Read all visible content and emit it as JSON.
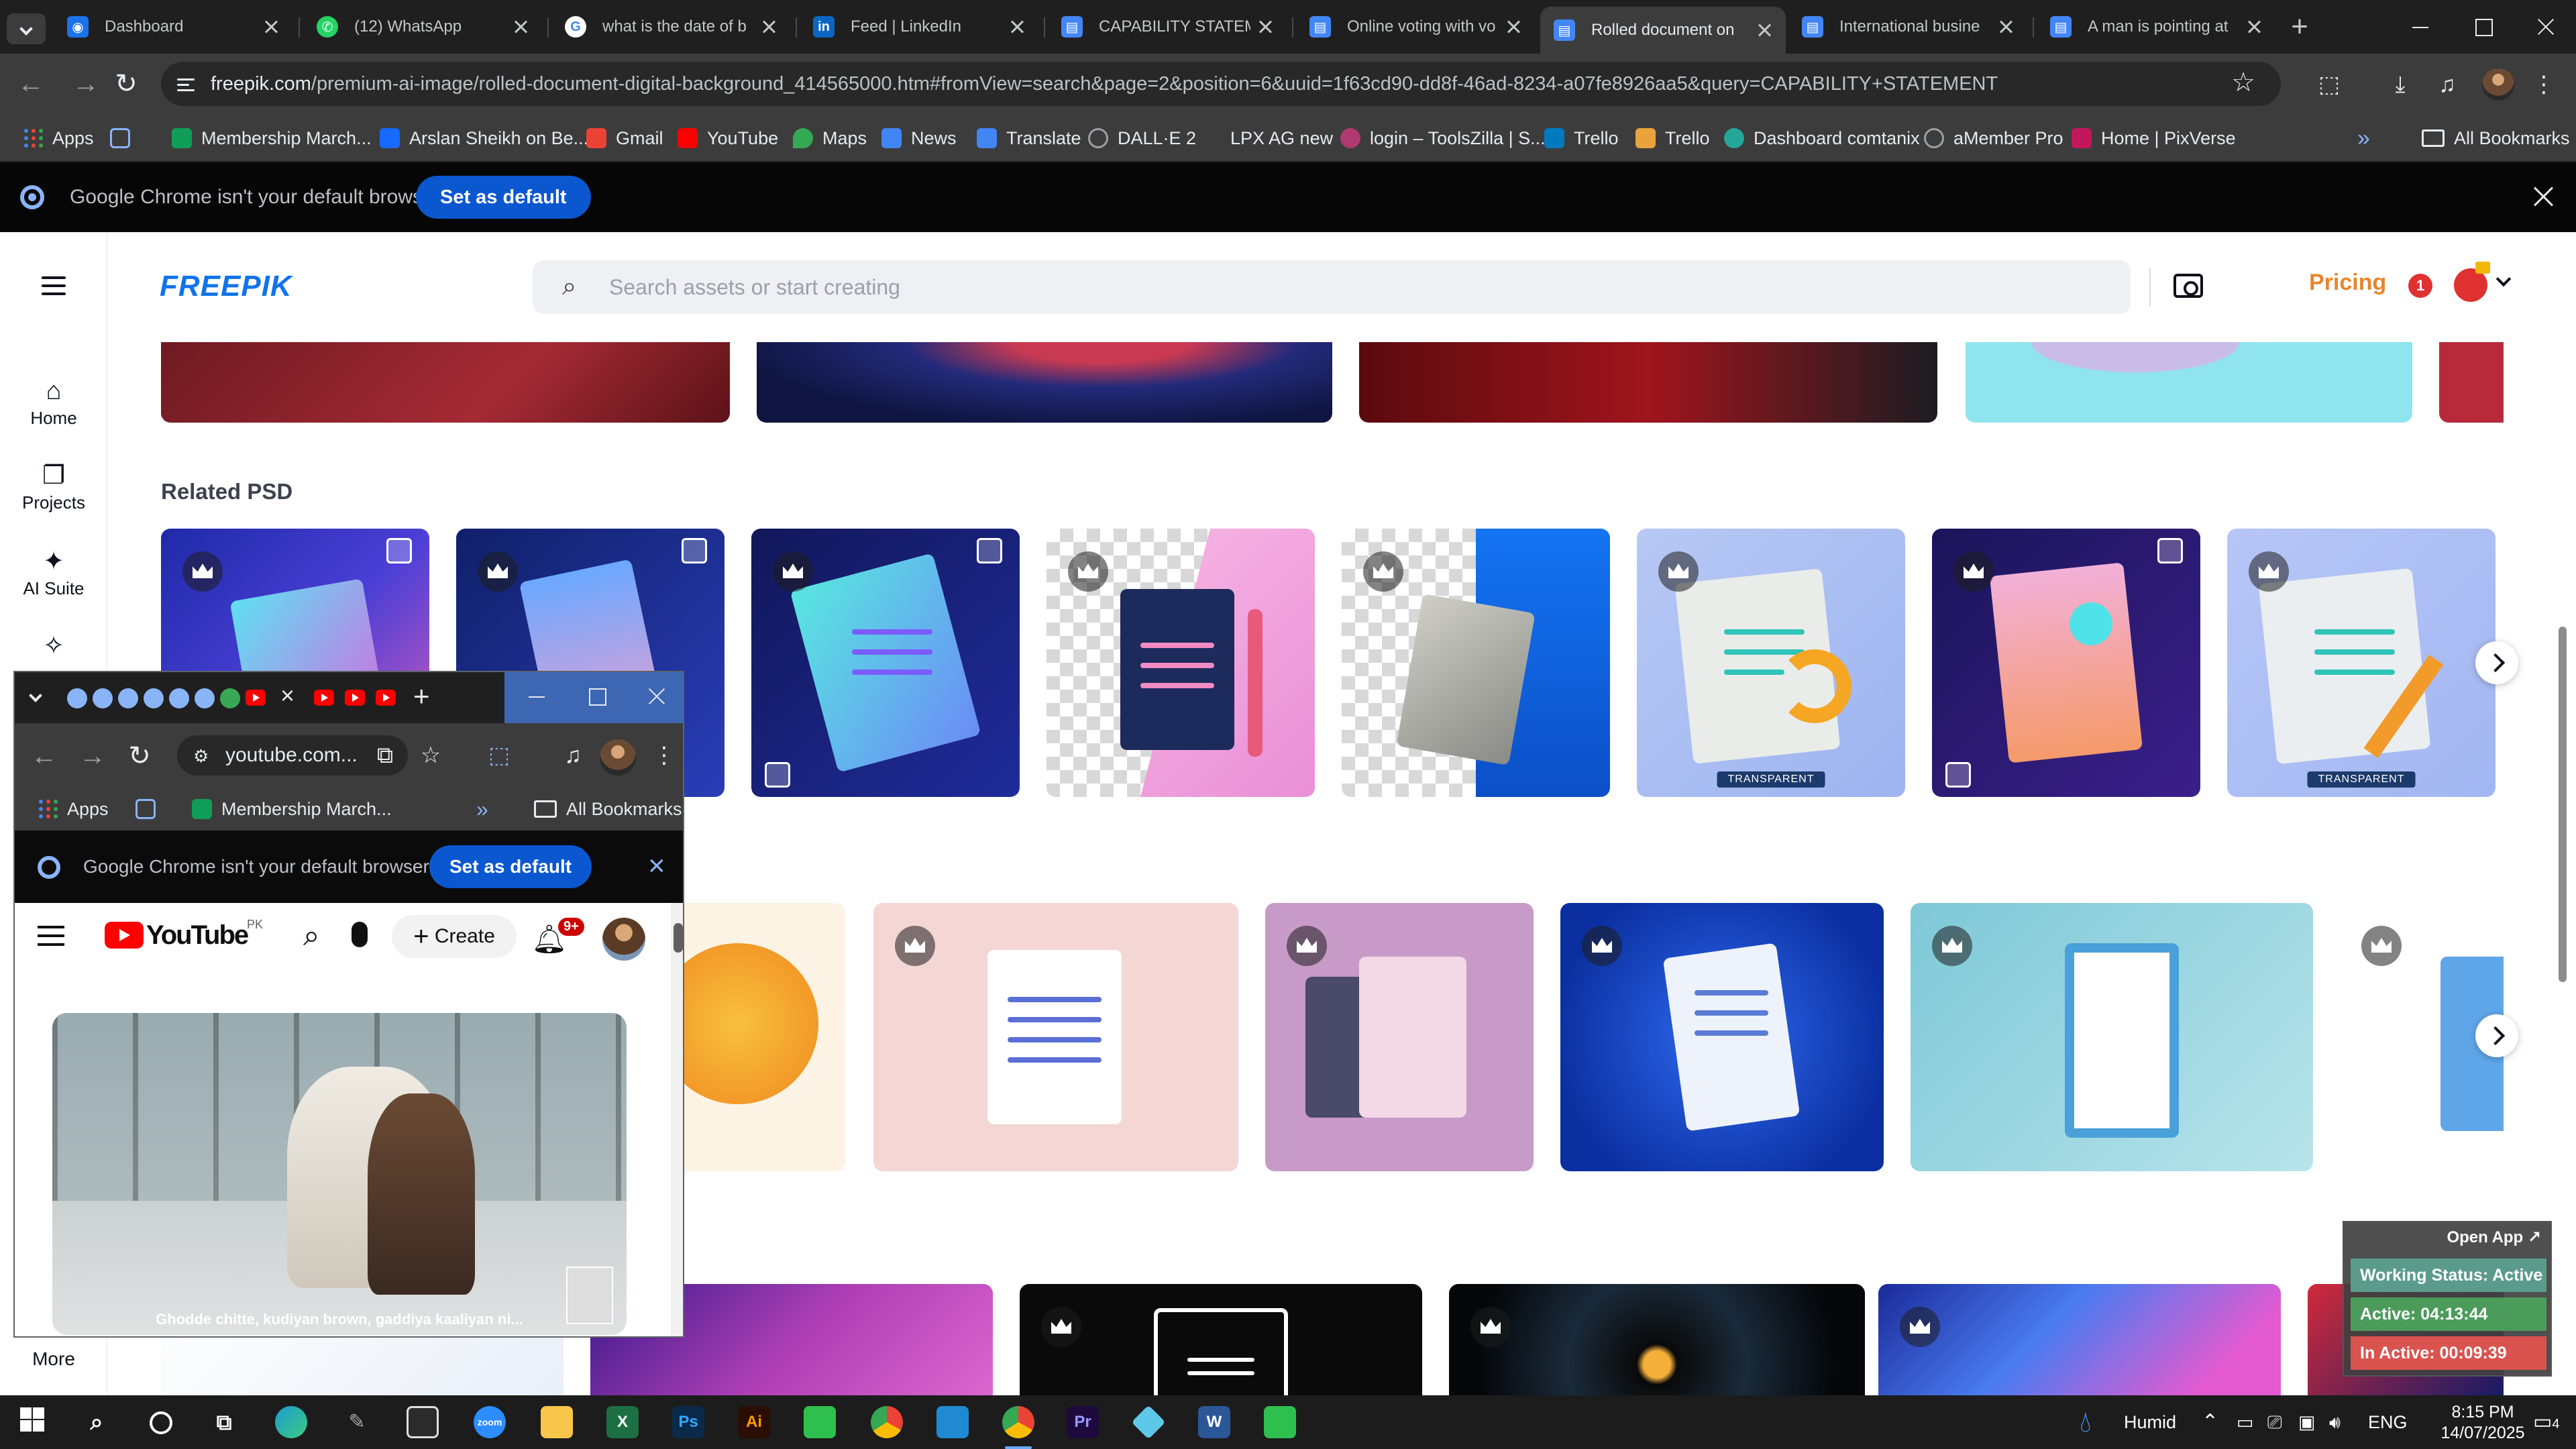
{
  "browser": {
    "tabs": [
      {
        "title": "Dashboard",
        "icon": "globe-icon",
        "color": "#1a73e8"
      },
      {
        "title": "(12) WhatsApp",
        "icon": "whatsapp-icon",
        "color": "#25d366"
      },
      {
        "title": "what is the date of b",
        "icon": "google-icon",
        "color": "#4285f4"
      },
      {
        "title": "Feed | LinkedIn",
        "icon": "linkedin-icon",
        "color": "#0a66c2"
      },
      {
        "title": "CAPABILITY STATEME",
        "icon": "docs-icon",
        "color": "#4285f4"
      },
      {
        "title": "Online voting with vo",
        "icon": "docs-icon",
        "color": "#4285f4"
      },
      {
        "title": "Rolled document on",
        "icon": "docs-icon",
        "color": "#4285f4"
      },
      {
        "title": "International busine",
        "icon": "docs-icon",
        "color": "#4285f4"
      },
      {
        "title": "A man is pointing at",
        "icon": "docs-icon",
        "color": "#4285f4"
      }
    ],
    "active_tab_index": 6,
    "new_tab_symbol": "+",
    "url_domain": "freepik.com",
    "url_rest": "/premium-ai-image/rolled-document-digital-background_414565000.htm#fromView=search&page=2&position=6&uuid=1f63cd90-dd8f-46ad-8234-a07fe8926aa5&query=CAPABILITY+STATEMENT",
    "bookmarks": [
      {
        "label": "Apps",
        "icon": "apps-icon",
        "color": ""
      },
      {
        "label": "",
        "icon": "tab-groups-icon",
        "color": "#8ab4f8"
      },
      {
        "label": "Membership March...",
        "icon": "membership-icon",
        "color": "#0f9d58"
      },
      {
        "label": "Arslan Sheikh on Be...",
        "icon": "behance-icon",
        "color": "#1769ff"
      },
      {
        "label": "Gmail",
        "icon": "gmail-icon",
        "color": "#ea4335"
      },
      {
        "label": "YouTube",
        "icon": "youtube-icon",
        "color": "#ff0000"
      },
      {
        "label": "Maps",
        "icon": "maps-icon",
        "color": "#34a853"
      },
      {
        "label": "News",
        "icon": "news-icon",
        "color": "#4285f4"
      },
      {
        "label": "Translate",
        "icon": "translate-icon",
        "color": "#4285f4"
      },
      {
        "label": "DALL·E 2",
        "icon": "openai-icon",
        "color": "#9aa0a6"
      },
      {
        "label": "LPX AG new",
        "icon": "blank-page-icon",
        "color": "#3c3c3c"
      },
      {
        "label": "login – ToolsZilla | S...",
        "icon": "toolszilla-icon",
        "color": "#b03a6f"
      },
      {
        "label": "Trello",
        "icon": "trello-icon",
        "color": "#0079bf"
      },
      {
        "label": "Trello",
        "icon": "trello-icon",
        "color": "#e8a33d"
      },
      {
        "label": "Dashboard comtanix",
        "icon": "comtanix-icon",
        "color": "#26a69a"
      },
      {
        "label": "aMember Pro",
        "icon": "amember-icon",
        "color": "#9aa0a6"
      },
      {
        "label": "Home | PixVerse",
        "icon": "pixverse-icon",
        "color": "#c2185b"
      }
    ],
    "bookmarks_overflow": "»",
    "all_bookmarks": "All Bookmarks",
    "infobar": {
      "message": "Google Chrome isn't your default browser",
      "button": "Set as default"
    }
  },
  "freepik": {
    "logo": "FREEPIK",
    "search_placeholder": "Search assets or start creating",
    "pricing": "Pricing",
    "notification_count": "1",
    "sidebar": [
      {
        "label": "Home",
        "icon": "home-icon"
      },
      {
        "label": "Projects",
        "icon": "projects-icon"
      },
      {
        "label": "AI Suite",
        "icon": "ai-suite-icon"
      }
    ],
    "more_label": "More",
    "related_psd_title": "Related PSD",
    "transparent_badge": "TRANSPARENT",
    "accent_color": "#1273eb",
    "pricing_color": "#e8852e"
  },
  "youtube_window": {
    "url": "youtube.com...",
    "apps_label": "Apps",
    "bookmark_membership": "Membership March...",
    "overflow": "»",
    "all_bookmarks": "All Bookmarks",
    "infobar_message": "Google Chrome isn't your default browser",
    "infobar_button": "Set as default",
    "logo_text": "YouTube",
    "country_code": "PK",
    "create_label": "Create",
    "notification_badge": "9+",
    "video_title": "Ghodde chitte, kudiyan brown, gaddiya kaaliyan ni..."
  },
  "work_status": {
    "open_app": "Open App ↗",
    "status": "Working Status: Active",
    "active": "Active: 04:13:44",
    "inactive": "In Active: 00:09:39"
  },
  "taskbar": {
    "apps": [
      {
        "name": "windows-start",
        "color": "#4aa3ff"
      },
      {
        "name": "search",
        "color": "#ffffff"
      },
      {
        "name": "cortana",
        "color": "#ffffff"
      },
      {
        "name": "task-view",
        "color": "#ffffff"
      },
      {
        "name": "edge",
        "color": "#1d9bd1"
      },
      {
        "name": "pen-tool",
        "color": "#9aa0a6"
      },
      {
        "name": "terminal",
        "color": "#2b2b2b"
      },
      {
        "name": "zoom",
        "color": "#2d8cff"
      },
      {
        "name": "file-explorer",
        "color": "#f8c64a"
      },
      {
        "name": "excel",
        "color": "#1d7044"
      },
      {
        "name": "photoshop",
        "color": "#0b2a4a"
      },
      {
        "name": "illustrator",
        "color": "#2a0e04"
      },
      {
        "name": "camtasia",
        "color": "#2fbf4f"
      },
      {
        "name": "chrome",
        "color": "#4285f4"
      },
      {
        "name": "vscode",
        "color": "#1f8ad2"
      },
      {
        "name": "chrome-active",
        "color": "#4285f4"
      },
      {
        "name": "premiere",
        "color": "#1e0a3c"
      },
      {
        "name": "app-diamond",
        "color": "#5ec8e8"
      },
      {
        "name": "word",
        "color": "#2b5797"
      },
      {
        "name": "camtasia-2",
        "color": "#2fbf4f"
      }
    ],
    "weather": "Humid",
    "language": "ENG",
    "time": "8:15 PM",
    "date": "14/07/2025",
    "notification_count": "4"
  }
}
